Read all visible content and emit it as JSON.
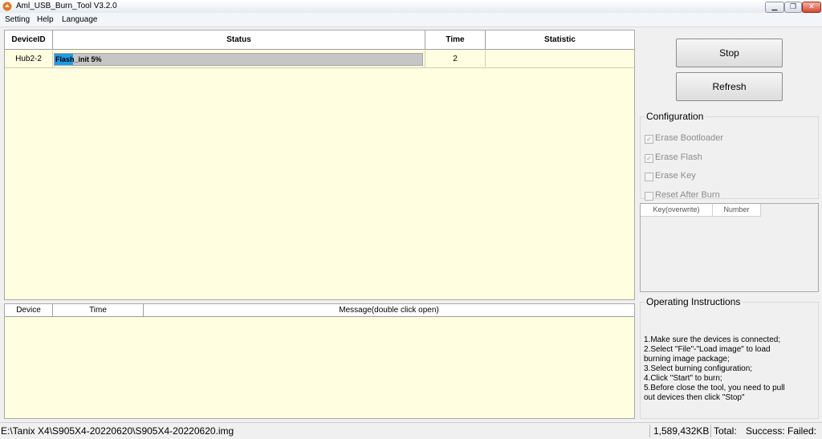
{
  "window": {
    "title": "Aml_USB_Burn_Tool V3.2.0",
    "icon": "amlogic-app-icon",
    "controls": {
      "minimize": "▁",
      "restore": "❐",
      "close": "✕"
    }
  },
  "menu": {
    "items": [
      "Setting",
      "Help",
      "Language"
    ]
  },
  "device_table": {
    "headers": {
      "device_id": "DeviceID",
      "status": "Status",
      "time": "Time",
      "statistic": "Statistic"
    },
    "rows": [
      {
        "device_id": "Hub2-2",
        "status_text": "Flash_init 5%",
        "progress_percent": 5,
        "time": "2",
        "statistic": ""
      }
    ]
  },
  "log_table": {
    "headers": {
      "device": "Device",
      "time": "Time",
      "message": "Message(double click open)"
    }
  },
  "buttons": {
    "stop": "Stop",
    "refresh": "Refresh"
  },
  "configuration": {
    "title": "Configuration",
    "options": [
      {
        "label": "Erase Bootloader",
        "checked": true
      },
      {
        "label": "Erase Flash",
        "checked": true
      },
      {
        "label": "Erase Key",
        "checked": false
      },
      {
        "label": "Reset After Burn",
        "checked": false
      }
    ]
  },
  "key_table": {
    "headers": {
      "key": "Key(overwrite)",
      "number": "Number"
    }
  },
  "instructions": {
    "title": "Operating Instructions",
    "lines": [
      "1.Make sure the devices is connected;",
      "2.Select \"File\"-\"Load image\" to load",
      "burning image package;",
      "3.Select burning configuration;",
      "4.Click \"Start\" to burn;",
      "5.Before close the tool, you need to pull",
      "out devices then click \"Stop\""
    ]
  },
  "status_bar": {
    "image_path": "E:\\Tanix X4\\S905X4-20220620\\S905X4-20220620.img",
    "size": "1,589,432KB",
    "total_label": "Total:",
    "success_label": "Success:",
    "failed_label": "Failed:"
  },
  "colors": {
    "panel_background": "#fffee0",
    "progress_fill": "#1e9be6",
    "progress_track": "#c6c6c6"
  }
}
